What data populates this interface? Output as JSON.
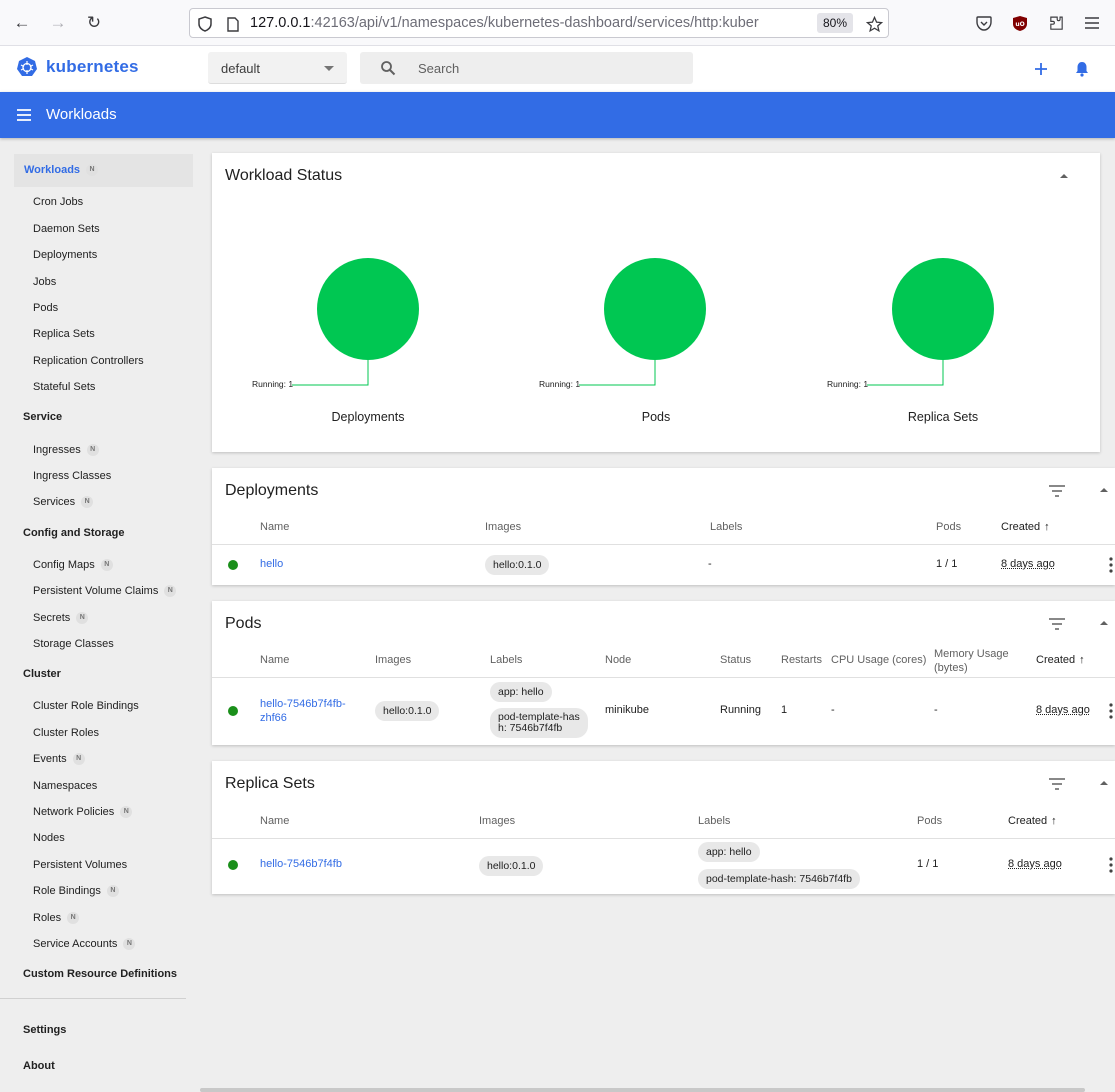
{
  "browser": {
    "url_host": "127.0.0.1",
    "url_rest": ":42163/api/v1/namespaces/kubernetes-dashboard/services/http:kuber",
    "zoom": "80%"
  },
  "header": {
    "brand": "kubernetes",
    "namespace": "default",
    "search_placeholder": "Search"
  },
  "toolbar": {
    "title": "Workloads"
  },
  "sidebar": {
    "active": "Workloads",
    "active_badge": "N",
    "workload_items": [
      "Cron Jobs",
      "Daemon Sets",
      "Deployments",
      "Jobs",
      "Pods",
      "Replica Sets",
      "Replication Controllers",
      "Stateful Sets"
    ],
    "service_section": "Service",
    "service_items": [
      {
        "label": "Ingresses",
        "badge": "N"
      },
      {
        "label": "Ingress Classes",
        "badge": ""
      },
      {
        "label": "Services",
        "badge": "N"
      }
    ],
    "config_section": "Config and Storage",
    "config_items": [
      {
        "label": "Config Maps",
        "badge": "N"
      },
      {
        "label": "Persistent Volume Claims",
        "badge": "N"
      },
      {
        "label": "Secrets",
        "badge": "N"
      },
      {
        "label": "Storage Classes",
        "badge": ""
      }
    ],
    "cluster_section": "Cluster",
    "cluster_items": [
      {
        "label": "Cluster Role Bindings",
        "badge": ""
      },
      {
        "label": "Cluster Roles",
        "badge": ""
      },
      {
        "label": "Events",
        "badge": "N"
      },
      {
        "label": "Namespaces",
        "badge": ""
      },
      {
        "label": "Network Policies",
        "badge": "N"
      },
      {
        "label": "Nodes",
        "badge": ""
      },
      {
        "label": "Persistent Volumes",
        "badge": ""
      },
      {
        "label": "Role Bindings",
        "badge": "N"
      },
      {
        "label": "Roles",
        "badge": "N"
      },
      {
        "label": "Service Accounts",
        "badge": "N"
      }
    ],
    "crd": "Custom Resource Definitions",
    "settings": "Settings",
    "about": "About"
  },
  "workload_status": {
    "title": "Workload Status",
    "charts": [
      {
        "name": "Deployments",
        "label": "Running: 1",
        "running": 1,
        "color": "#00c752"
      },
      {
        "name": "Pods",
        "label": "Running: 1",
        "running": 1,
        "color": "#00c752"
      },
      {
        "name": "Replica Sets",
        "label": "Running: 1",
        "running": 1,
        "color": "#00c752"
      }
    ]
  },
  "deployments": {
    "title": "Deployments",
    "headers": {
      "name": "Name",
      "images": "Images",
      "labels": "Labels",
      "pods": "Pods",
      "created": "Created"
    },
    "row": {
      "name": "hello",
      "image": "hello:0.1.0",
      "labels": "-",
      "pods": "1 / 1",
      "created": "8 days ago"
    }
  },
  "pods": {
    "title": "Pods",
    "headers": {
      "name": "Name",
      "images": "Images",
      "labels": "Labels",
      "node": "Node",
      "status": "Status",
      "restarts": "Restarts",
      "cpu": "CPU Usage (cores)",
      "memory_1": "Memory Usage",
      "memory_2": "(bytes)",
      "created": "Created"
    },
    "row": {
      "name_1": "hello-7546b7f4fb-",
      "name_2": "zhf66",
      "image": "hello:0.1.0",
      "label_1": "app: hello",
      "label_2a": "pod-template-has",
      "label_2b": "h: 7546b7f4fb",
      "node": "minikube",
      "status": "Running",
      "restarts": "1",
      "cpu": "-",
      "memory": "-",
      "created": "8 days ago"
    }
  },
  "replica_sets": {
    "title": "Replica Sets",
    "headers": {
      "name": "Name",
      "images": "Images",
      "labels": "Labels",
      "pods": "Pods",
      "created": "Created"
    },
    "row": {
      "name": "hello-7546b7f4fb",
      "image": "hello:0.1.0",
      "label_1": "app: hello",
      "label_2": "pod-template-hash: 7546b7f4fb",
      "pods": "1 / 1",
      "created": "8 days ago"
    }
  },
  "colors": {
    "brand": "#326ce5",
    "running": "#00c752",
    "status_dot": "#1a8f1a"
  }
}
